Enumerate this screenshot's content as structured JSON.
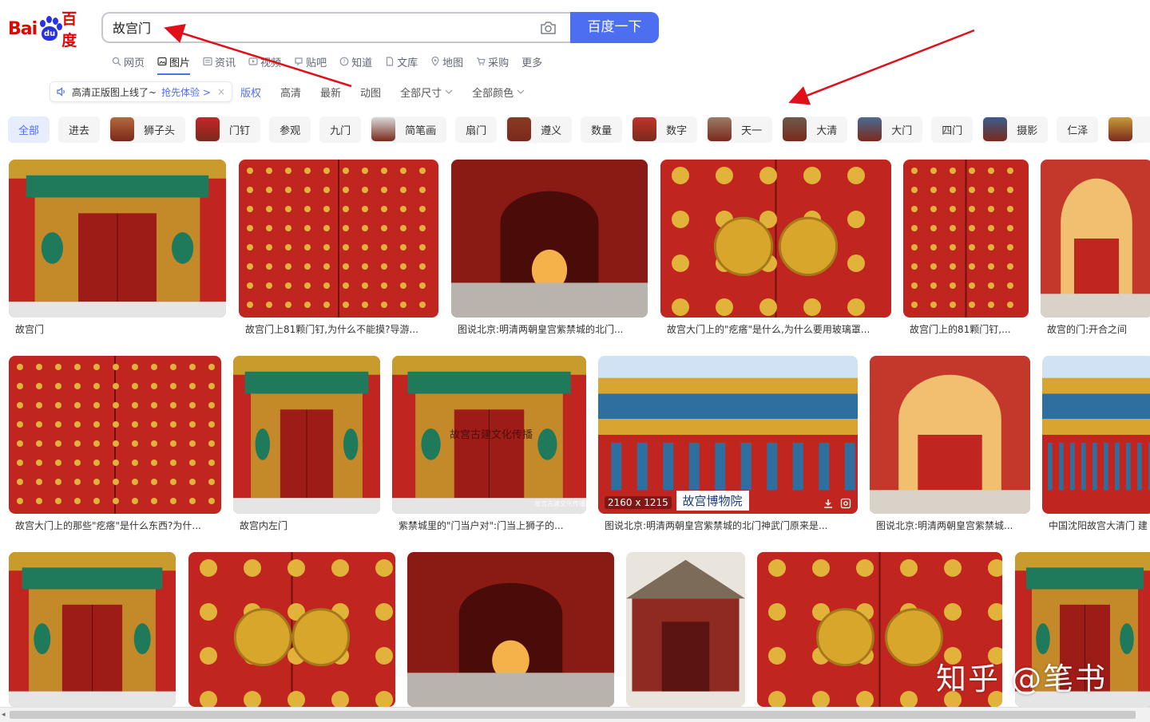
{
  "logo": {
    "bai": "Bai",
    "du": "du",
    "cn": "百度"
  },
  "search": {
    "query": "故宫门",
    "button_label": "百度一下"
  },
  "nav": [
    {
      "label": "网页",
      "icon": "search-icon"
    },
    {
      "label": "图片",
      "icon": "image-icon",
      "active": true
    },
    {
      "label": "资讯",
      "icon": "news-icon"
    },
    {
      "label": "视频",
      "icon": "video-icon"
    },
    {
      "label": "贴吧",
      "icon": "tieba-icon"
    },
    {
      "label": "知道",
      "icon": "question-icon"
    },
    {
      "label": "文库",
      "icon": "doc-icon"
    },
    {
      "label": "地图",
      "icon": "map-icon"
    },
    {
      "label": "采购",
      "icon": "cart-icon"
    },
    {
      "label": "更多",
      "icon": ""
    }
  ],
  "promo": {
    "text": "高清正版图上线了~",
    "link": "抢先体验 >",
    "close": "×"
  },
  "filters": [
    {
      "label": "版权",
      "highlight": true
    },
    {
      "label": "高清"
    },
    {
      "label": "最新"
    },
    {
      "label": "动图"
    },
    {
      "label": "全部尺寸",
      "dropdown": true
    },
    {
      "label": "全部颜色",
      "dropdown": true
    }
  ],
  "tags": [
    {
      "label": "全部",
      "active": true
    },
    {
      "label": "进去"
    },
    {
      "label": "狮子头",
      "thumb": "#b5683c"
    },
    {
      "label": "门钉",
      "thumb": "#c4252a"
    },
    {
      "label": "参观"
    },
    {
      "label": "九门"
    },
    {
      "label": "简笔画",
      "thumb": "#d9d9d9"
    },
    {
      "label": "扇门"
    },
    {
      "label": "遵义",
      "thumb": "#8a3a22"
    },
    {
      "label": "数量"
    },
    {
      "label": "数字",
      "thumb": "#c0342b"
    },
    {
      "label": "天一",
      "thumb": "#9a7c66"
    },
    {
      "label": "大清",
      "thumb": "#6b5a4c"
    },
    {
      "label": "大门",
      "thumb": "#4b6a91"
    },
    {
      "label": "四门"
    },
    {
      "label": "摄影",
      "thumb": "#3a5d8c"
    },
    {
      "label": "仁泽"
    },
    {
      "label": "",
      "thumb": "#c89a3a"
    }
  ],
  "images": {
    "row1": [
      {
        "caption": "故宫门"
      },
      {
        "caption": "故宫门上81颗门钉,为什么不能摸?导游..."
      },
      {
        "caption": "图说北京:明清两朝皇宫紫禁城的北门..."
      },
      {
        "caption": "故宫大门上的\"疙瘩\"是什么,为什么要用玻璃罩..."
      },
      {
        "caption": "故宫门上的81颗门钉,..."
      },
      {
        "caption": "故宫的门:开合之间"
      }
    ],
    "row2": [
      {
        "caption": "故宫大门上的那些\"疙瘩\"是什么东西?为什..."
      },
      {
        "caption": "故宫内左门"
      },
      {
        "caption": "紫禁城里的\"门当户对\":门当上狮子的..."
      },
      {
        "caption": "图说北京:明清两朝皇宫紫禁城的北门神武门原来是...",
        "size": "2160 x 1215",
        "sign": "故宫博物院"
      },
      {
        "caption": "图说北京:明清两朝皇宫紫禁城..."
      },
      {
        "caption": "中国沈阳故宫大清门 建"
      }
    ],
    "row3": [
      {
        "caption": ""
      },
      {
        "caption": ""
      },
      {
        "caption": ""
      },
      {
        "caption": ""
      },
      {
        "caption": ""
      },
      {
        "caption": ""
      }
    ]
  },
  "image_texts": {
    "plaque": "故宫博物院",
    "overlay_text": "故宫古建文化传播",
    "small_mark": "故宫古建文化传播"
  },
  "watermark": "知乎 @笔书",
  "colors": {
    "brand_blue": "#4e6ef2",
    "baidu_red": "#e10602",
    "palace_red": "#c0261f",
    "arrow_red": "#e0101a"
  }
}
